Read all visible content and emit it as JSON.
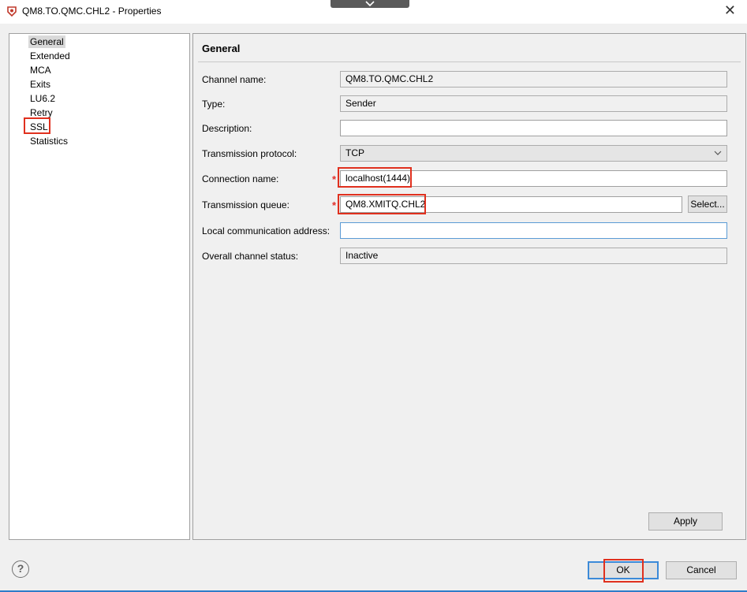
{
  "window": {
    "title": "QM8.TO.QMC.CHL2 - Properties",
    "close_glyph": "✕"
  },
  "nav": {
    "items": [
      {
        "label": "General",
        "selected": true
      },
      {
        "label": "Extended"
      },
      {
        "label": "MCA"
      },
      {
        "label": "Exits"
      },
      {
        "label": "LU6.2"
      },
      {
        "label": "Retry"
      },
      {
        "label": "SSL",
        "highlighted": true
      },
      {
        "label": "Statistics"
      }
    ]
  },
  "general": {
    "title": "General",
    "channel_name": {
      "label": "Channel name:",
      "value": "QM8.TO.QMC.CHL2"
    },
    "type": {
      "label": "Type:",
      "value": "Sender"
    },
    "description": {
      "label": "Description:",
      "value": ""
    },
    "transmission_protocol": {
      "label": "Transmission protocol:",
      "value": "TCP"
    },
    "connection_name": {
      "label": "Connection name:",
      "value": "localhost(1444)",
      "required": true,
      "highlighted": true
    },
    "transmission_queue": {
      "label": "Transmission queue:",
      "value": "QM8.XMITQ.CHL2",
      "required": true,
      "highlighted": true
    },
    "local_comm_address": {
      "label": "Local communication address:",
      "value": ""
    },
    "overall_status": {
      "label": "Overall channel status:",
      "value": "Inactive"
    },
    "required_marker": "*",
    "select_button": "Select...",
    "apply_button": "Apply"
  },
  "footer": {
    "help_glyph": "?",
    "ok_button": "OK",
    "cancel_button": "Cancel"
  },
  "colors": {
    "highlight_box": "#e0301e",
    "required": "#e0302b",
    "focus": "#3c8ad8"
  }
}
